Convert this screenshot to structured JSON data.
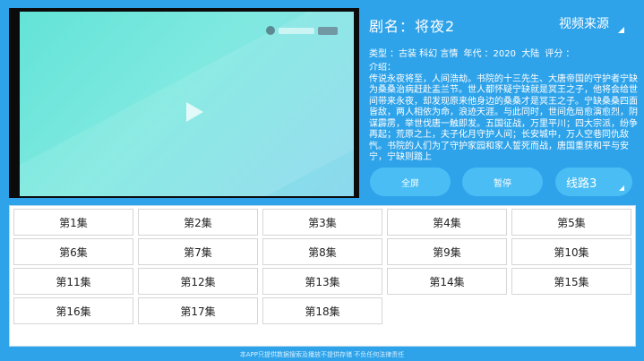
{
  "player": {
    "watermark_icon": "tv-logo-icon",
    "play_icon": "play-icon"
  },
  "detail": {
    "title": "剧名：将夜2",
    "source_label": "视频来源",
    "meta": [
      "类型",
      "：古装 科幻 言情",
      "年代",
      "：2020",
      "大陆",
      "评分",
      "："
    ],
    "intro": "介绍：\n传说永夜将至，人间浩劫。书院的十三先生、大唐帝国的守护者宁缺为桑桑治病赶赴盂兰节。世人都怀疑宁缺就是冥王之子，他将会给世间带来永夜，却发现原来他身边的桑桑才是冥王之子。宁缺桑桑四面皆敌，两人相依为命，浪迹天涯。与此同时，世间危局愈演愈烈，阴谋霹雳，举世伐唐一触即发。五国征战，万里平川；四大宗派，纷争再起；荒原之上，夫子化月守护人间；长安城中，万人空巷同仇敌忾。书院的人们为了守护家园和家人誓死而战，唐国重获和平与安宁，宁缺则踏上"
  },
  "controls": {
    "fullscreen": "全屏",
    "pause": "暂停",
    "route": "线路3"
  },
  "episodes": [
    "第1集",
    "第2集",
    "第3集",
    "第4集",
    "第5集",
    "第6集",
    "第7集",
    "第8集",
    "第9集",
    "第10集",
    "第11集",
    "第12集",
    "第13集",
    "第14集",
    "第15集",
    "第16集",
    "第17集",
    "第18集"
  ],
  "footer": "本APP只提供数据搜索及播放不提供存储 不负任何法律责任",
  "colors": {
    "background": "#2ea3ea",
    "button": "#49bdf4",
    "video_tint": "#7fe9e0"
  }
}
